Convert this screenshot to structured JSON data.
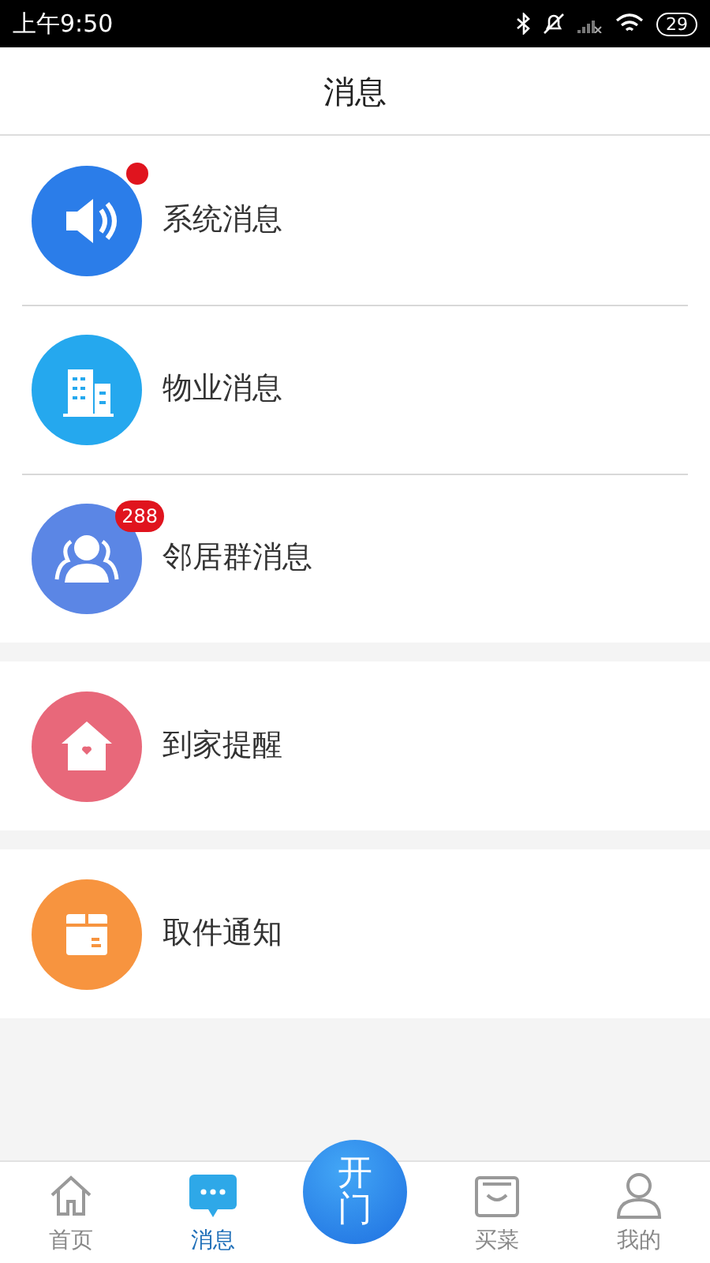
{
  "status_bar": {
    "time": "上午9:50",
    "battery": "29"
  },
  "header": {
    "title": "消息"
  },
  "groups": [
    {
      "items": [
        {
          "color": "#2b7de9",
          "label": "系统消息",
          "badge": {
            "kind": "dot"
          }
        },
        {
          "color": "#25a8ee",
          "label": "物业消息"
        },
        {
          "color": "#5b86e5",
          "label": "邻居群消息",
          "badge": {
            "kind": "count",
            "text": "288"
          }
        }
      ]
    },
    {
      "items": [
        {
          "color": "#e8687a",
          "label": "到家提醒"
        }
      ]
    },
    {
      "items": [
        {
          "color": "#f7943f",
          "label": "取件通知"
        }
      ]
    }
  ],
  "tabs": [
    {
      "kind": "tab",
      "label": "首页",
      "selected": false
    },
    {
      "kind": "tab",
      "label": "消息",
      "selected": true
    },
    {
      "kind": "center",
      "label": "开门"
    },
    {
      "kind": "tab",
      "label": "买菜",
      "selected": false
    },
    {
      "kind": "tab",
      "label": "我的",
      "selected": false
    }
  ]
}
